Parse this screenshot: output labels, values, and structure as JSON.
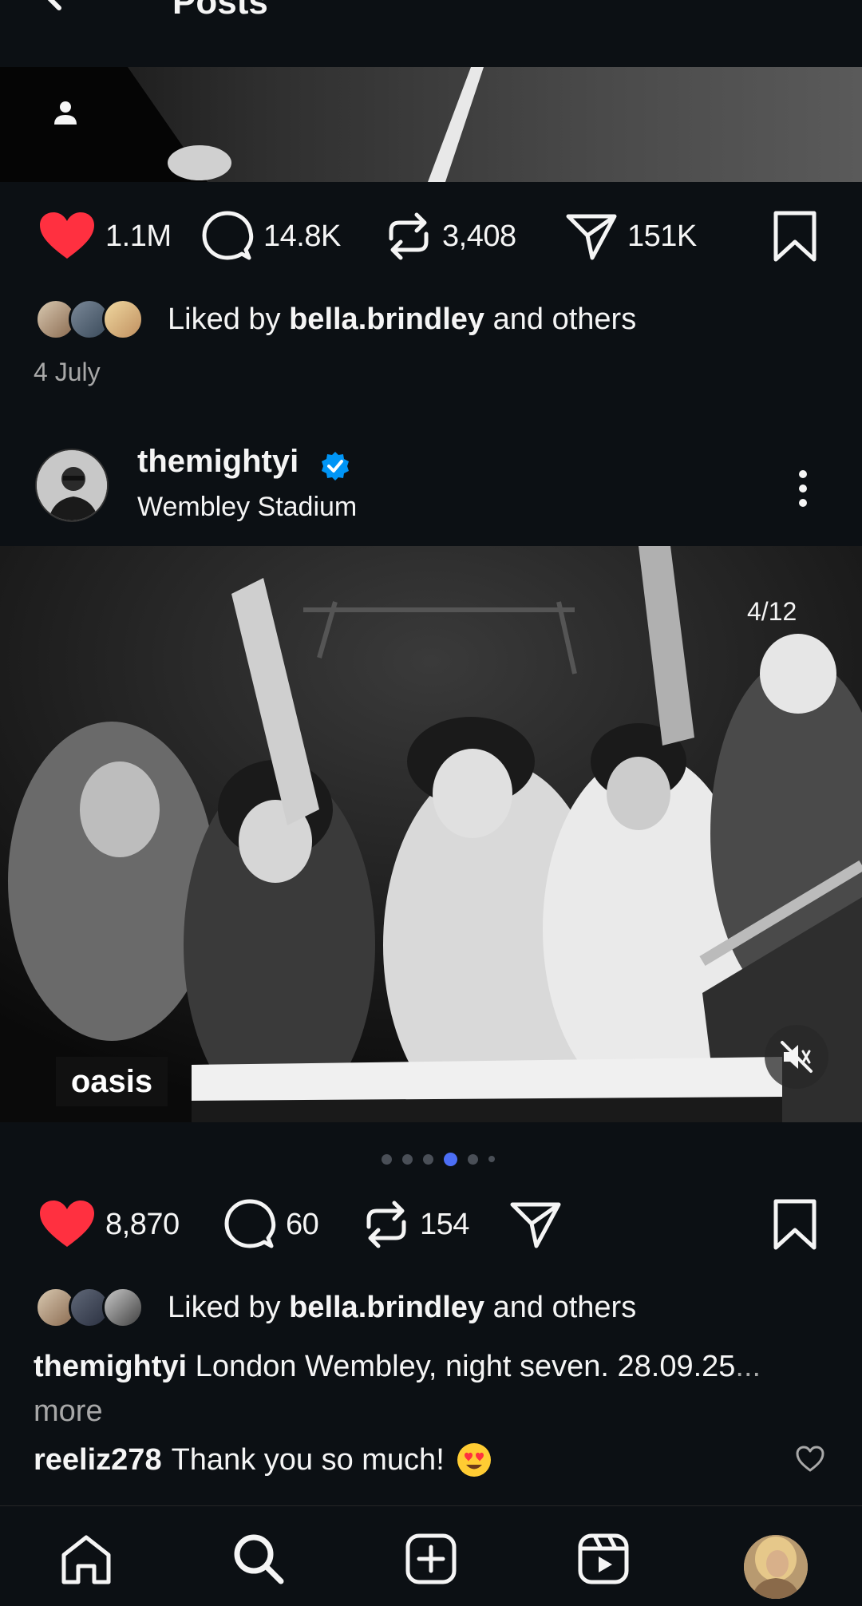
{
  "header": {
    "title": "Posts"
  },
  "previous_post": {
    "likes": "1.1M",
    "comments": "14.8K",
    "reposts": "3,408",
    "shares": "151K",
    "liked_by_prefix": "Liked by ",
    "liked_by_user": "bella.brindley",
    "liked_by_suffix": " and others",
    "date": "4 July"
  },
  "post": {
    "username": "themightyi",
    "location": "Wembley Stadium",
    "image_counter": "4/12",
    "image_logo_text": "oasis",
    "likes": "8,870",
    "comments": "60",
    "reposts": "154",
    "liked_by_prefix": "Liked by ",
    "liked_by_user": "bella.brindley",
    "liked_by_suffix": " and others",
    "caption_user": "themightyi",
    "caption_text": " London Wembley, night seven. 28.09.25",
    "caption_more": "... more",
    "comment_user": "reeliz278",
    "comment_text": "Thank you so much!"
  },
  "colors": {
    "background": "#0c1014",
    "like_red": "#ff3040",
    "verified_blue": "#0095f6",
    "dot_active": "#4c6ef5",
    "muted_text": "#a8a8a8"
  },
  "nav": {
    "items": [
      "home-icon",
      "search-icon",
      "create-icon",
      "reels-icon",
      "profile"
    ]
  }
}
